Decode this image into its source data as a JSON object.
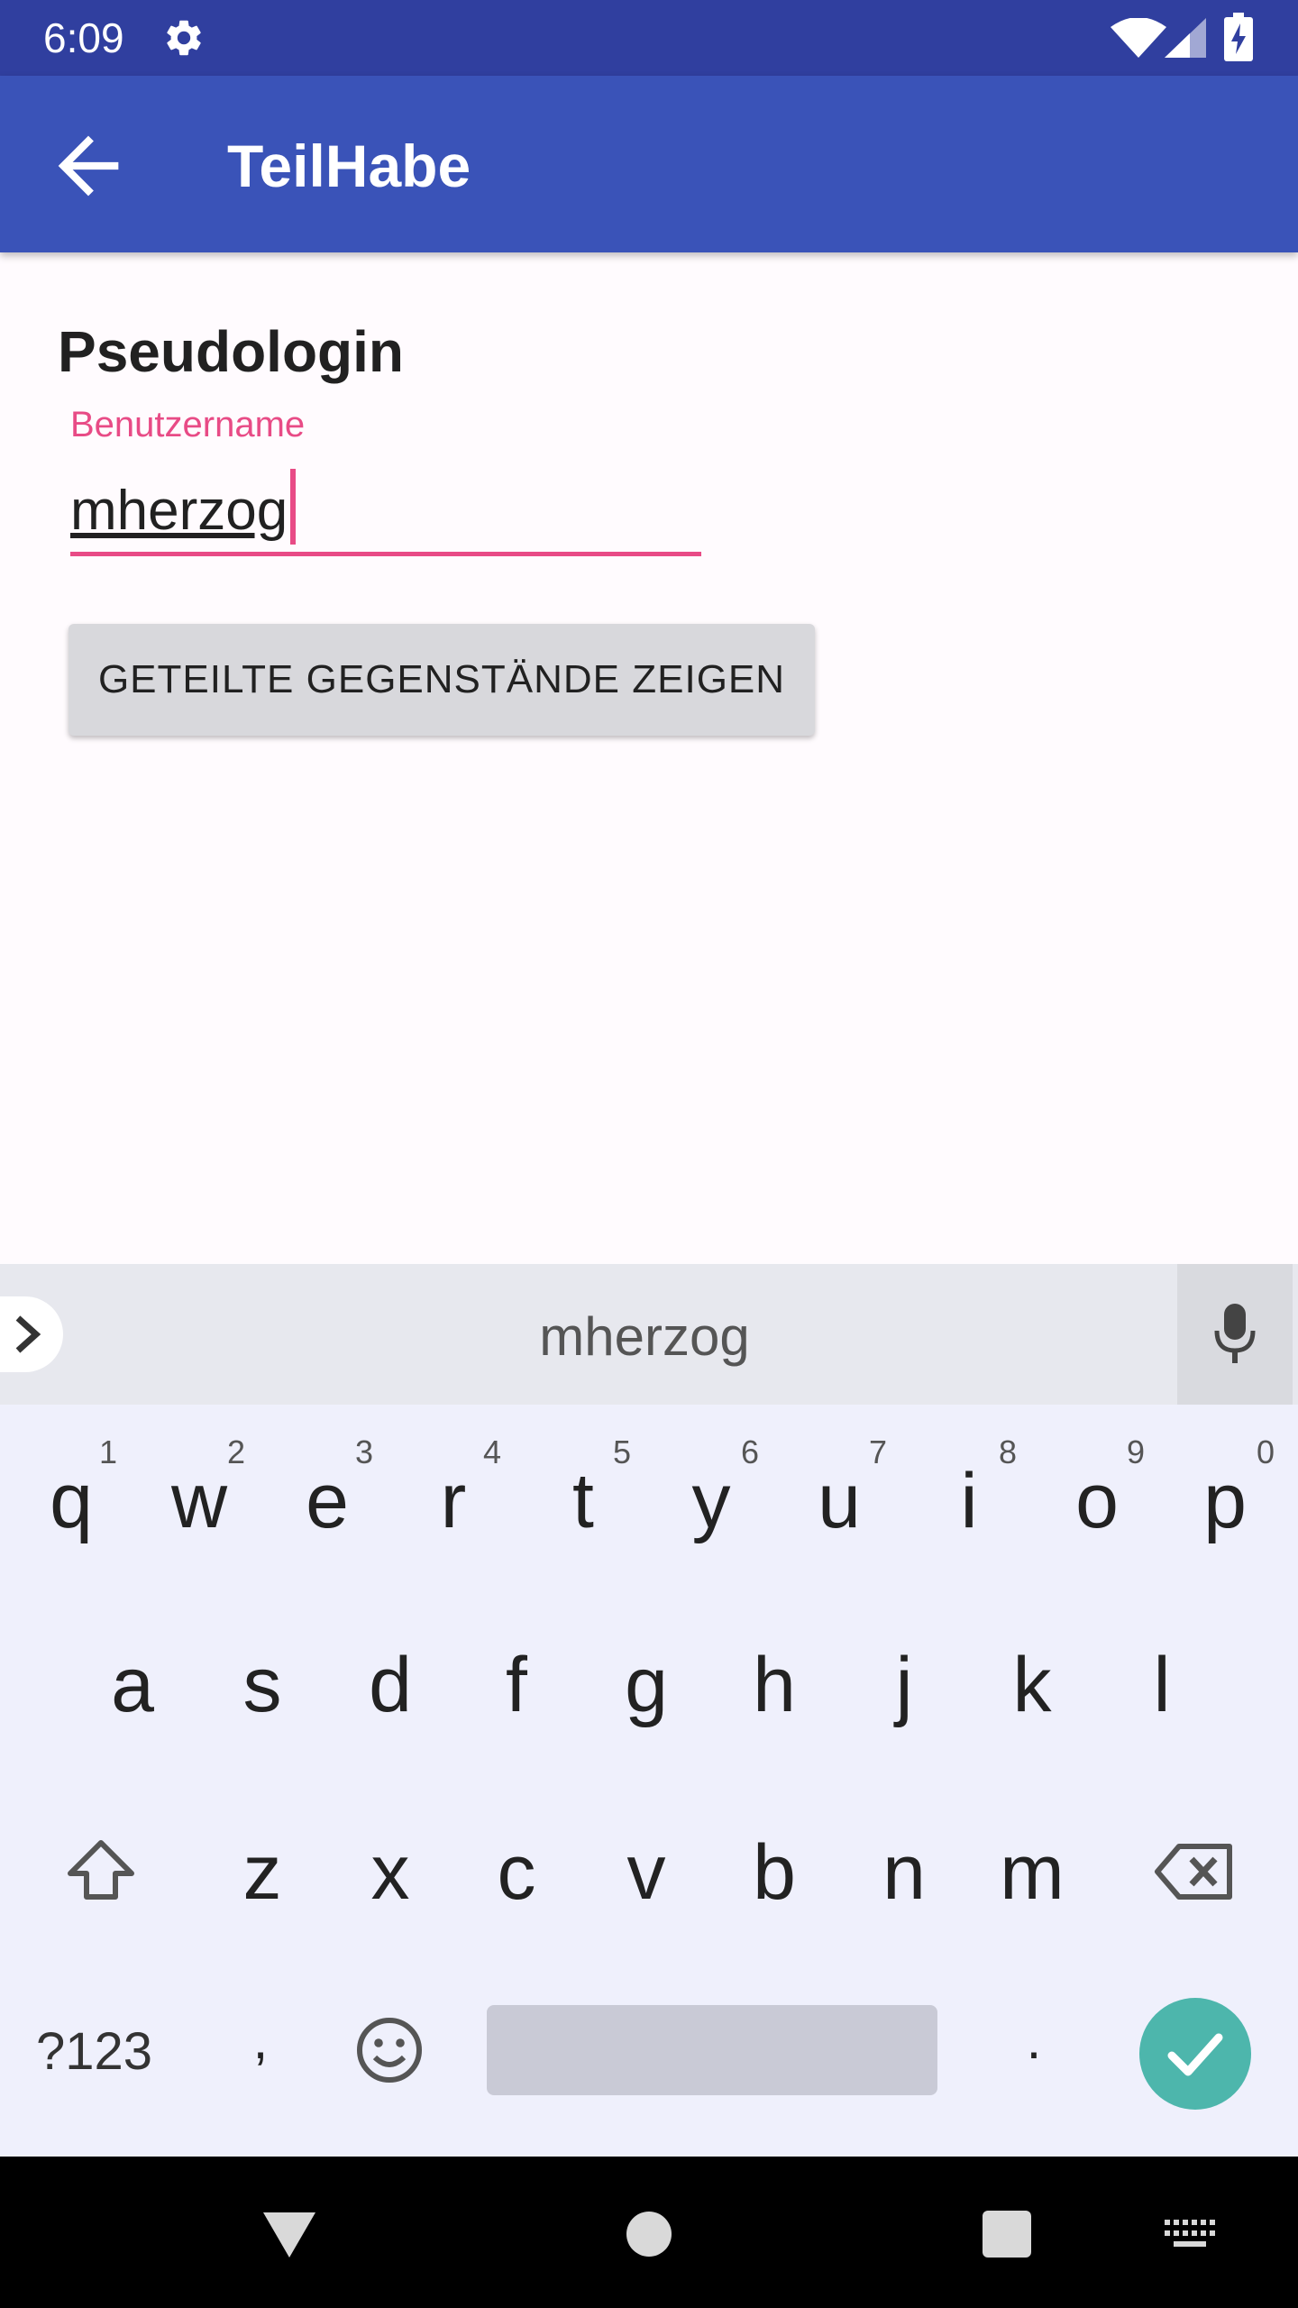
{
  "status_bar": {
    "time": "6:09",
    "icons": [
      "settings-gear-icon",
      "wifi-icon",
      "cell-signal-icon",
      "battery-charging-icon"
    ]
  },
  "app_bar": {
    "back_icon": "arrow-back-icon",
    "title": "TeilHabe"
  },
  "content": {
    "heading": "Pseudologin",
    "username_label": "Benutzername",
    "username_value": "mherzog",
    "show_button_label": "GETEILTE GEGENSTÄNDE ZEIGEN"
  },
  "keyboard": {
    "suggestion": "mherzog",
    "expand_icon": "chevron-right-icon",
    "mic_icon": "microphone-icon",
    "row1": [
      "q",
      "w",
      "e",
      "r",
      "t",
      "y",
      "u",
      "i",
      "o",
      "p"
    ],
    "row1_hints": [
      "1",
      "2",
      "3",
      "4",
      "5",
      "6",
      "7",
      "8",
      "9",
      "0"
    ],
    "row2": [
      "a",
      "s",
      "d",
      "f",
      "g",
      "h",
      "j",
      "k",
      "l"
    ],
    "row3": [
      "z",
      "x",
      "c",
      "v",
      "b",
      "n",
      "m"
    ],
    "shift_icon": "shift-icon",
    "backspace_icon": "backspace-icon",
    "symbols_label": "?123",
    "comma": ",",
    "emoji_icon": "emoji-icon",
    "period": ".",
    "enter_icon": "checkmark-icon",
    "accent_color": "#4db6ac"
  },
  "nav_bar": {
    "icons": [
      "nav-back-icon",
      "nav-home-icon",
      "nav-recents-icon",
      "keyboard-switch-icon"
    ]
  },
  "colors": {
    "status_bar": "#303f9f",
    "app_bar": "#3a53b8",
    "accent_pink": "#e84b86"
  }
}
